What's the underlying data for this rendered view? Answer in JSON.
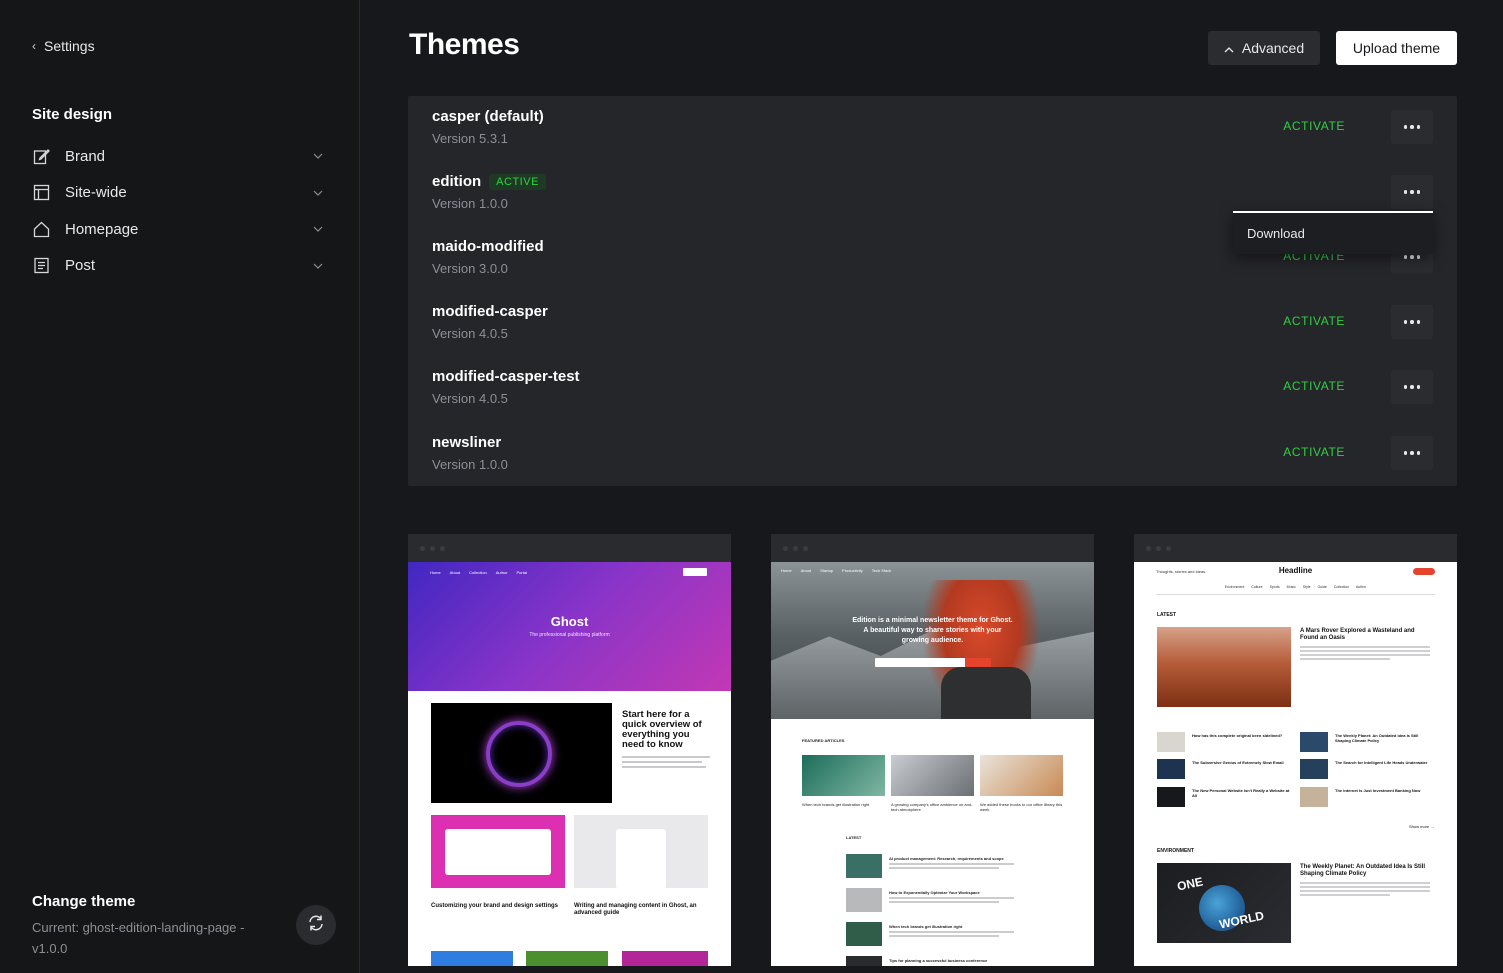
{
  "sidebar": {
    "back_label": "Settings",
    "section_heading": "Site design",
    "items": [
      {
        "label": "Brand",
        "icon": "edit-icon"
      },
      {
        "label": "Site-wide",
        "icon": "layout-icon"
      },
      {
        "label": "Homepage",
        "icon": "home-icon"
      },
      {
        "label": "Post",
        "icon": "document-icon"
      }
    ],
    "change_theme": {
      "title": "Change theme",
      "current": "Current: ghost-edition-landing-page - v1.0.0"
    }
  },
  "header": {
    "title": "Themes",
    "advanced_label": "Advanced",
    "upload_label": "Upload theme"
  },
  "themes": [
    {
      "name": "casper (default)",
      "version": "Version 5.3.1",
      "action": "ACTIVATE"
    },
    {
      "name": "edition",
      "version": "Version 1.0.0",
      "badge": "ACTIVE"
    },
    {
      "name": "maido-modified",
      "version": "Version 3.0.0",
      "action": "ACTIVATE"
    },
    {
      "name": "modified-casper",
      "version": "Version 4.0.5",
      "action": "ACTIVATE"
    },
    {
      "name": "modified-casper-test",
      "version": "Version 4.0.5",
      "action": "ACTIVATE"
    },
    {
      "name": "newsliner",
      "version": "Version 1.0.0",
      "action": "ACTIVATE"
    }
  ],
  "dropdown": {
    "download_label": "Download"
  },
  "previews": {
    "casper": {
      "nav": [
        "Home",
        "About",
        "Collection",
        "Author",
        "Portal"
      ],
      "title": "Ghost",
      "tagline": "The professional publishing platform",
      "feature_title": "Start here for a quick overview of everything you need to know",
      "card1_title": "Customizing your brand and design settings",
      "card2_title": "Writing and managing content in Ghost, an advanced guide"
    },
    "edition": {
      "nav": [
        "Home",
        "About",
        "Startup",
        "Productivity",
        "Tech Stack"
      ],
      "hero_text": "Edition is a minimal newsletter theme for Ghost. A beautiful way to share stories with your growing audience.",
      "section": "FEATURED ARTICLES",
      "captions": [
        "When tech brands get illustration right",
        "A growing company's office ambience on and-tech atmosphere",
        "We added these books to our office library this week"
      ],
      "latest": "LATEST",
      "list": [
        "AI product management: Research, requirements and scope",
        "How to Exponentially Optimize Your Workspace",
        "When tech brands get illustration right",
        "Tips for planning a successful business conference"
      ]
    },
    "headline": {
      "top": "Thoughts, stories and ideas.",
      "logo": "Headline",
      "nav": "Environment Culture Sports Music Style Guide Collection Author",
      "latest": "LATEST",
      "feature_title": "A Mars Rover Explored a Wasteland and Found an Oasis",
      "items": [
        "How has this complete original been sidelined?",
        "The Weekly Planet: An Outdated Idea Is Still Shaping Climate Policy",
        "The Subversive Genius of Extremely Slow Email",
        "The Search for Intelligent Life Heads Underwater",
        "The New Personal Website Isn't Really a Website at All",
        "The Internet Is Just Investment Banking Now"
      ],
      "more": "Show more →",
      "env_label": "ENVIRONMENT",
      "env_title": "The Weekly Planet: An Outdated Idea Is Still Shaping Climate Policy",
      "env_words": [
        "ONE",
        "WORLD"
      ]
    }
  }
}
